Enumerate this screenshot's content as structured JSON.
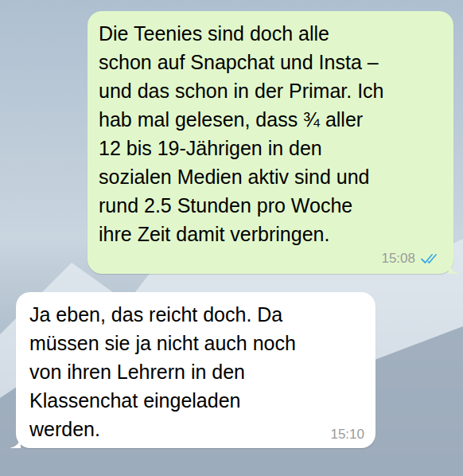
{
  "chat": {
    "messages": [
      {
        "kind": "sent",
        "lines": [
          "Die Teenies sind doch alle",
          "schon auf Snapchat und Insta –",
          "und das schon in der Primar. Ich",
          "hab mal gelesen, dass ¾ aller",
          "12 bis 19-Jährigen in den",
          "sozialen Medien aktiv sind und",
          "rund 2.5 Stunden pro Woche",
          "ihre Zeit damit verbringen."
        ],
        "time": "15:08",
        "read": true
      },
      {
        "kind": "received",
        "lines": [
          "Ja eben, das reicht doch. Da",
          "müssen sie ja nicht auch noch",
          "von ihren Lehrern in den",
          "Klassenchat eingeladen",
          "werden."
        ],
        "time": "15:10",
        "read": false
      }
    ]
  }
}
